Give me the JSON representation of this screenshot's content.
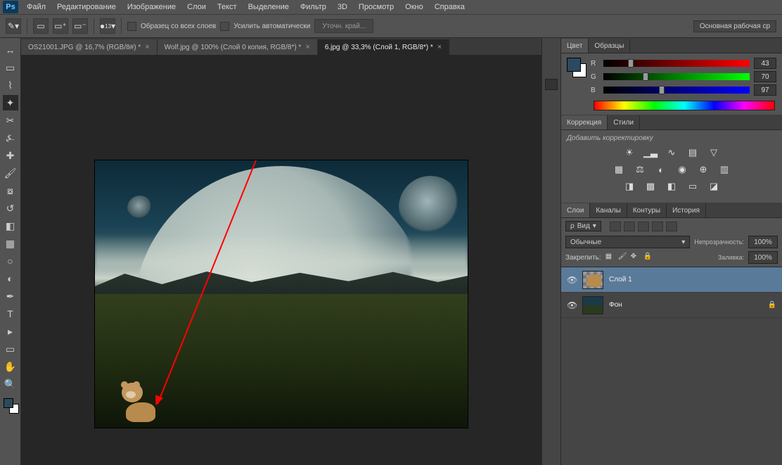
{
  "menu": {
    "items": [
      "Файл",
      "Редактирование",
      "Изображение",
      "Слои",
      "Текст",
      "Выделение",
      "Фильтр",
      "3D",
      "Просмотр",
      "Окно",
      "Справка"
    ]
  },
  "options": {
    "sample_all": "Образец со всех слоев",
    "auto_enhance": "Усилить автоматически",
    "refine": "Уточн. край...",
    "workspace": "Основная рабочая ср",
    "brush_size": "13"
  },
  "tabs": [
    {
      "title": "OS21001.JPG @ 16,7% (RGB/8#) *",
      "active": false
    },
    {
      "title": "Wolf.jpg @ 100% (Слой 0 копия, RGB/8*) *",
      "active": false
    },
    {
      "title": "6.jpg @ 33,3% (Слой 1, RGB/8*) *",
      "active": true
    }
  ],
  "panels": {
    "color": {
      "tabs": [
        "Цвет",
        "Образцы"
      ],
      "active": 0,
      "channels": [
        {
          "label": "R",
          "value": "43",
          "grad": "linear-gradient(90deg,#000,#f00)",
          "pos": 17
        },
        {
          "label": "G",
          "value": "70",
          "grad": "linear-gradient(90deg,#000,#0f0)",
          "pos": 27
        },
        {
          "label": "B",
          "value": "97",
          "grad": "linear-gradient(90deg,#000,#00f)",
          "pos": 38
        }
      ]
    },
    "adjustments": {
      "tabs": [
        "Коррекция",
        "Стили"
      ],
      "active": 0,
      "hint": "Добавить корректировку"
    },
    "layers": {
      "tabs": [
        "Слои",
        "Каналы",
        "Контуры",
        "История"
      ],
      "active": 0,
      "filter_label": "Вид",
      "blend_mode": "Обычные",
      "opacity_label": "Непрозрачность:",
      "opacity_value": "100%",
      "lock_label": "Закрепить:",
      "fill_label": "Заливка:",
      "fill_value": "100%",
      "items": [
        {
          "name": "Слой 1",
          "selected": true,
          "thumb": "checker",
          "locked": false
        },
        {
          "name": "Фон",
          "selected": false,
          "thumb": "bgimg",
          "locked": true
        }
      ]
    }
  }
}
